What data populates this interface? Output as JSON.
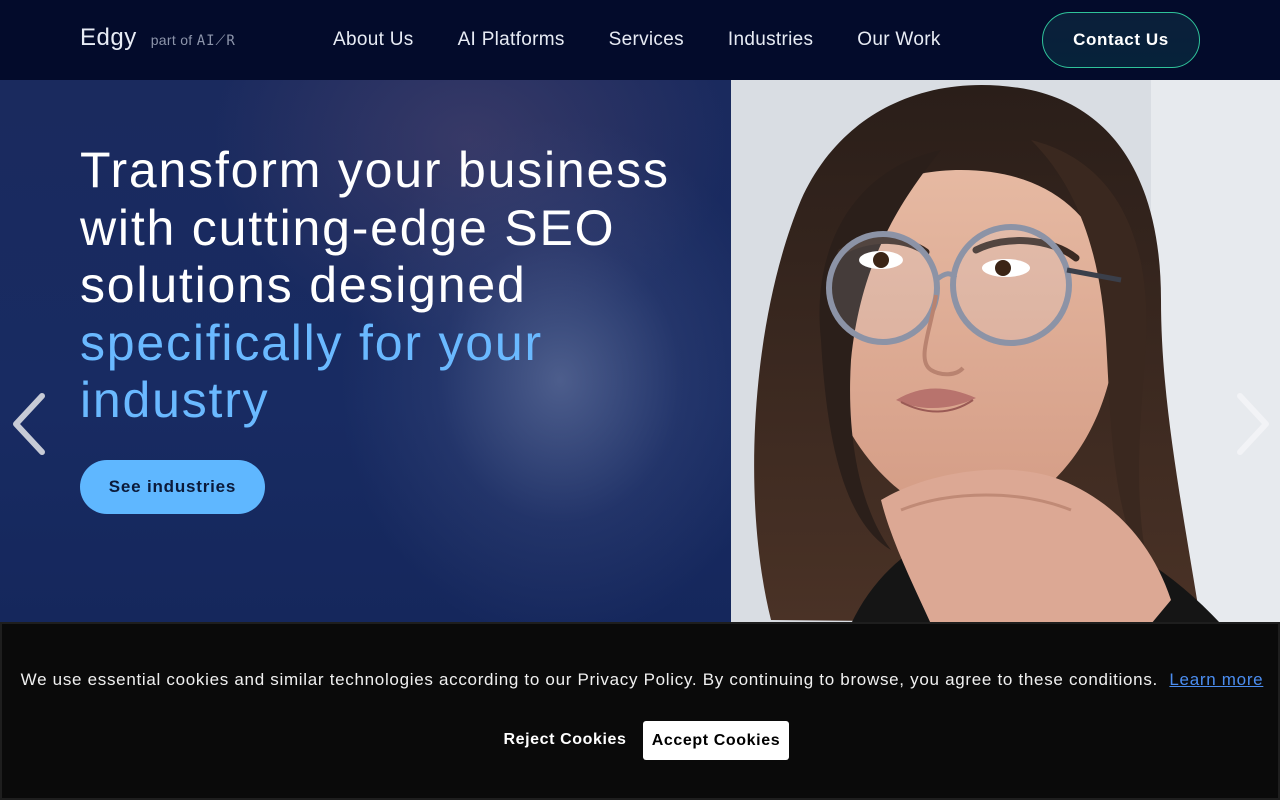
{
  "header": {
    "logo": "Edgy",
    "logo_suffix_prefix": "part of",
    "logo_suffix_brand": "AI⟋R",
    "nav": [
      {
        "label": "About Us"
      },
      {
        "label": "AI Platforms"
      },
      {
        "label": "Services"
      },
      {
        "label": "Industries"
      },
      {
        "label": "Our Work"
      }
    ],
    "contact_label": "Contact Us"
  },
  "hero": {
    "headline_line1": "Transform your business",
    "headline_line2": "with cutting-edge SEO",
    "headline_line3": "solutions designed",
    "headline_accent_line1": "specifically for your",
    "headline_accent_line2": "industry",
    "cta_label": "See industries",
    "prev_icon": "chevron-left-icon",
    "next_icon": "chevron-right-icon",
    "photo_alt": "woman-with-glasses-photo"
  },
  "cookie_banner": {
    "message": "We use essential cookies and similar technologies according to our Privacy Policy. By continuing to browse, you agree to these conditions.",
    "learn_more": "Learn more",
    "reject_label": "Reject Cookies",
    "accept_label": "Accept Cookies"
  },
  "colors": {
    "header_bg": "#030b2b",
    "accent_blue": "#6ab9ff",
    "cta_bg": "#5fb7ff",
    "contact_border": "#2fc39a",
    "cookie_bg": "#0a0a0a",
    "link": "#4b8df0"
  }
}
